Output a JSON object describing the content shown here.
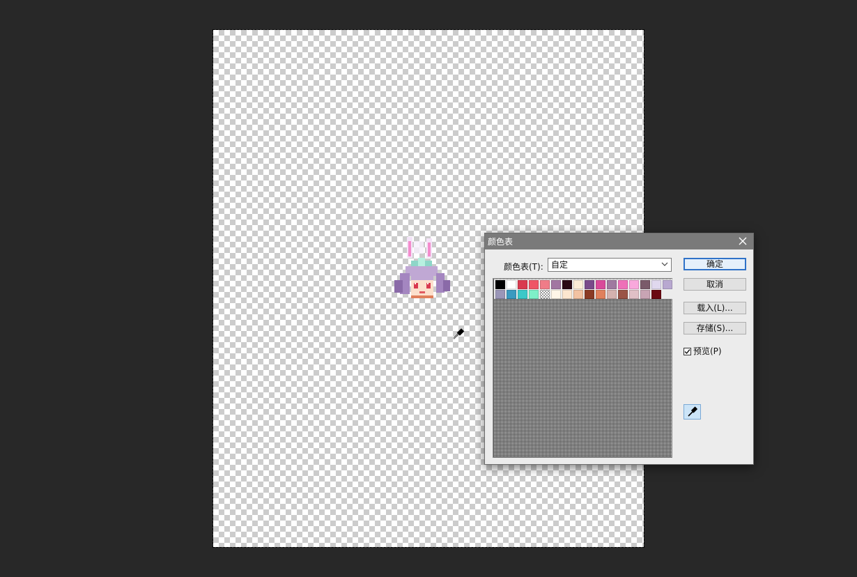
{
  "dialog": {
    "title": "颜色表",
    "table_label": "颜色表(T):",
    "table_value": "自定",
    "buttons": {
      "ok": "确定",
      "cancel": "取消",
      "load": "载入(L)...",
      "save": "存储(S)..."
    },
    "preview_label": "预览(P)",
    "preview_checked": true
  },
  "swatches": [
    "#000000",
    "#ffffff",
    "#d93a4f",
    "#ef5566",
    "#f07c88",
    "#a277a2",
    "#2a0a14",
    "#fbecd6",
    "#7a4a8a",
    "#d94a9a",
    "#a07aa0",
    "#ee70b8",
    "#f9a8dc",
    "#7a5a6a",
    "#e0d8ee",
    "#b8a8d0",
    "#9a96b8",
    "#3a9ac0",
    "#3ac8c8",
    "#7ef0c8",
    "transparent",
    "#fff6e8",
    "#fce6cf",
    "#f2c2a2",
    "#8a3a24",
    "#e0805c",
    "#d4b2ae",
    "#9a5446",
    "#e0c0c6",
    "#c8a4b4",
    "#6a0a12"
  ],
  "icons": {
    "close": "close-icon",
    "dropdown": "chevron-down-icon",
    "eyedropper": "eyedropper-icon",
    "cursor": "eyedropper-cursor-icon"
  }
}
